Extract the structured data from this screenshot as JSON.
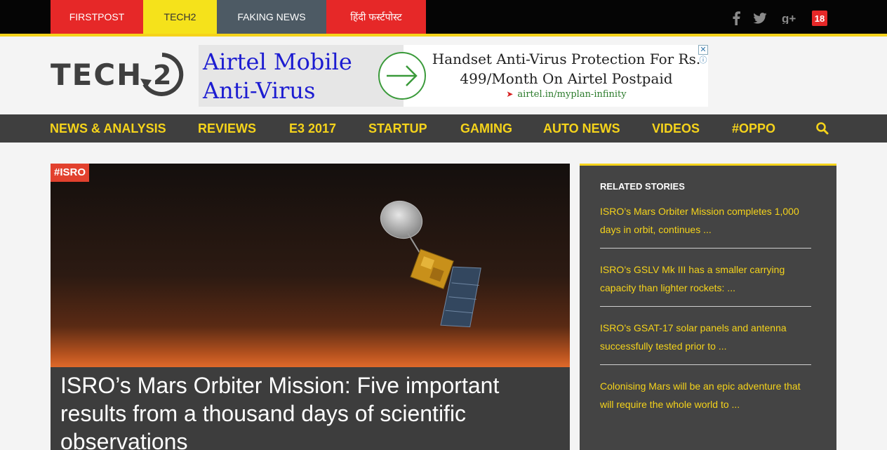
{
  "topbar": {
    "tabs": [
      {
        "label": "FIRSTPOST"
      },
      {
        "label": "TECH2"
      },
      {
        "label": "FAKING NEWS"
      },
      {
        "label": "हिंदी फर्स्टपोस्ट"
      }
    ],
    "social": [
      {
        "icon": "facebook-icon"
      },
      {
        "icon": "twitter-icon"
      },
      {
        "icon": "google-plus-icon"
      },
      {
        "icon": "network18-icon",
        "label": "18"
      }
    ]
  },
  "header": {
    "logo_text": "TECH",
    "ad": {
      "title": "Airtel Mobile Anti-Virus",
      "copy": "Handset Anti-Virus Protection For Rs. 499/Month On Airtel Postpaid",
      "url": "airtel.in/myplan-infinity"
    }
  },
  "nav": {
    "items": [
      {
        "label": "NEWS & ANALYSIS"
      },
      {
        "label": "REVIEWS"
      },
      {
        "label": "E3 2017"
      },
      {
        "label": "STARTUP"
      },
      {
        "label": "GAMING"
      },
      {
        "label": "AUTO NEWS"
      },
      {
        "label": "VIDEOS"
      },
      {
        "label": "#OPPO"
      }
    ],
    "search_icon": "search-icon"
  },
  "hero": {
    "tag": "#ISRO",
    "title": "ISRO’s Mars Orbiter Mission: Five important results from a thousand days of scientific observations"
  },
  "related": {
    "heading": "RELATED STORIES",
    "items": [
      {
        "title": "ISRO’s Mars Orbiter Mission completes 1,000 days in orbit, continues ..."
      },
      {
        "title": "ISRO’s GSLV Mk III has a smaller carrying capacity than lighter rockets: ..."
      },
      {
        "title": "ISRO’s GSAT-17 solar panels and antenna successfully tested prior to ..."
      },
      {
        "title": "Colonising Mars will be an epic adventure that will require the whole world to ..."
      }
    ]
  },
  "colors": {
    "accent_yellow": "#f5d31b",
    "firstpost_red": "#e62828",
    "nav_bg": "#3f3f3f",
    "faking_news": "#4d5a64"
  }
}
